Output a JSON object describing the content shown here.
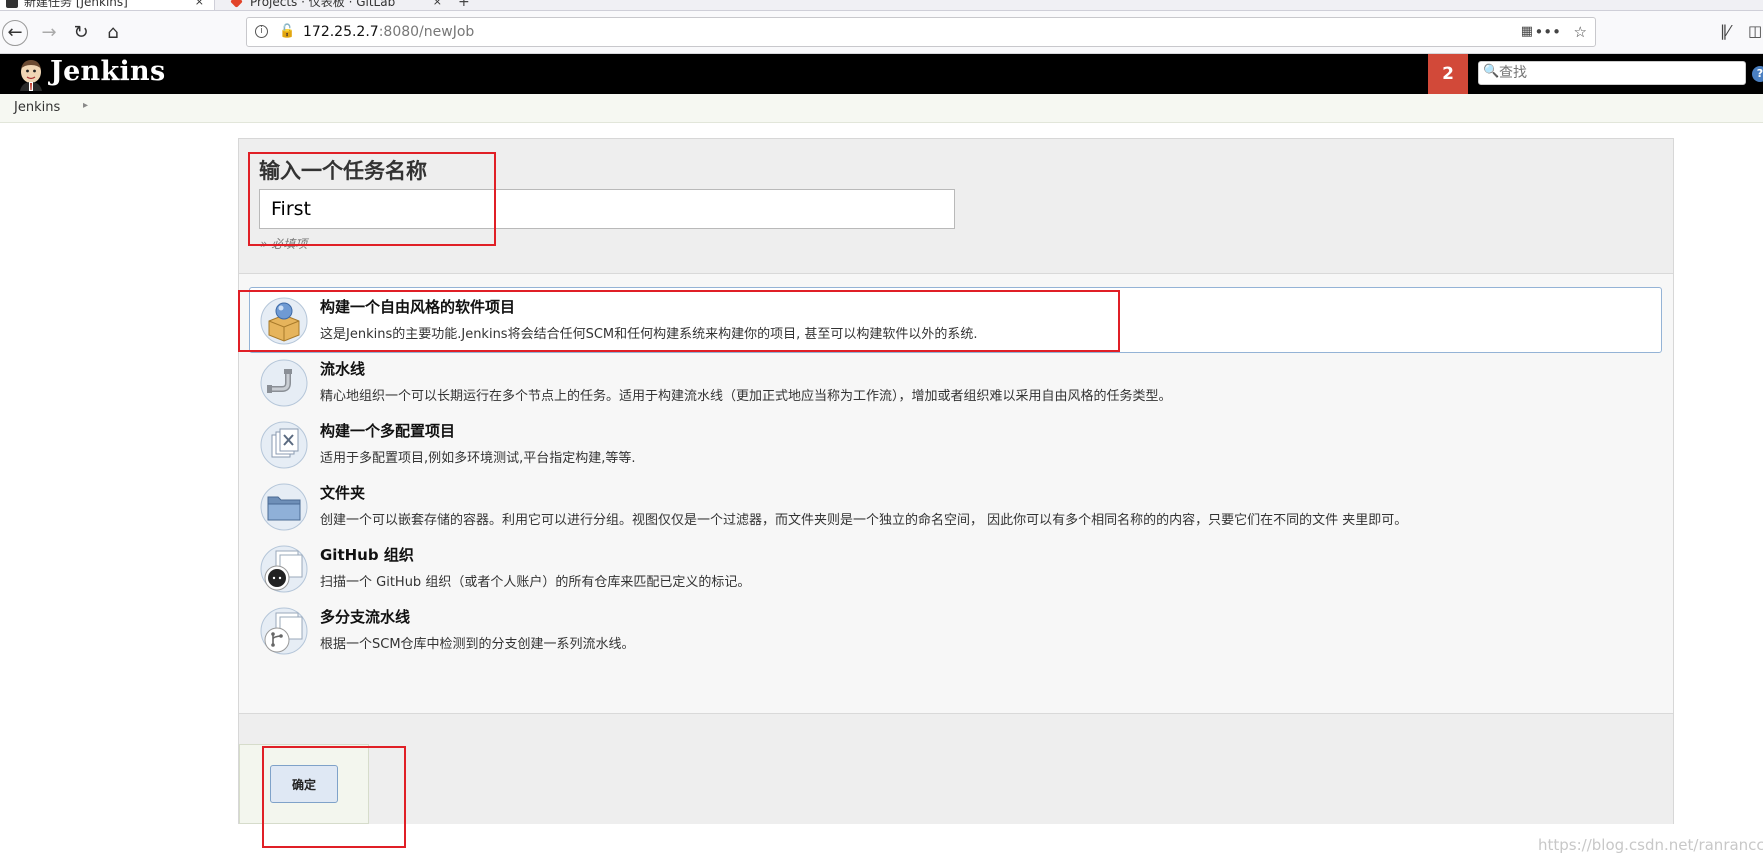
{
  "browser": {
    "tabs": [
      {
        "title": "新建任务 [Jenkins]",
        "close": "×"
      },
      {
        "title": "Projects · 仪表板 · GitLab",
        "close": "×"
      }
    ],
    "new_tab": "+",
    "url_host": "172.25.2.7",
    "url_path": ":8080/newJob",
    "more": "•••"
  },
  "header": {
    "title": "Jenkins",
    "notification_count": "2",
    "search_placeholder": "查找",
    "help": "?"
  },
  "breadcrumb": {
    "items": [
      "Jenkins"
    ]
  },
  "form": {
    "heading": "输入一个任务名称",
    "name_value": "First",
    "required_note": "» 必填项"
  },
  "item_types": [
    {
      "label": "构建一个自由风格的软件项目",
      "desc": "这是Jenkins的主要功能.Jenkins将会结合任何SCM和任何构建系统来构建你的项目, 甚至可以构建软件以外的系统.",
      "icon": "freestyle-project-icon",
      "selected": true
    },
    {
      "label": "流水线",
      "desc": "精心地组织一个可以长期运行在多个节点上的任务。适用于构建流水线（更加正式地应当称为工作流），增加或者组织难以采用自由风格的任务类型。",
      "icon": "pipeline-icon",
      "selected": false
    },
    {
      "label": "构建一个多配置项目",
      "desc": "适用于多配置项目,例如多环境测试,平台指定构建,等等.",
      "icon": "multi-config-icon",
      "selected": false
    },
    {
      "label": "文件夹",
      "desc": "创建一个可以嵌套存储的容器。利用它可以进行分组。视图仅仅是一个过滤器，而文件夹则是一个独立的命名空间， 因此你可以有多个相同名称的的内容，只要它们在不同的文件 夹里即可。",
      "icon": "folder-icon",
      "selected": false
    },
    {
      "label": "GitHub 组织",
      "desc": "扫描一个 GitHub 组织（或者个人账户）的所有仓库来匹配已定义的标记。",
      "icon": "github-org-icon",
      "selected": false
    },
    {
      "label": "多分支流水线",
      "desc": "根据一个SCM仓库中检测到的分支创建一系列流水线。",
      "icon": "multibranch-pipeline-icon",
      "selected": false
    }
  ],
  "ok_button": "确定",
  "watermark": "https://blog.csdn.net/ranrancc_",
  "colors": {
    "header_bg": "#000000",
    "notification_bg": "#d24939",
    "annotation": "#e01f26",
    "selected_border": "#94b3d6"
  }
}
